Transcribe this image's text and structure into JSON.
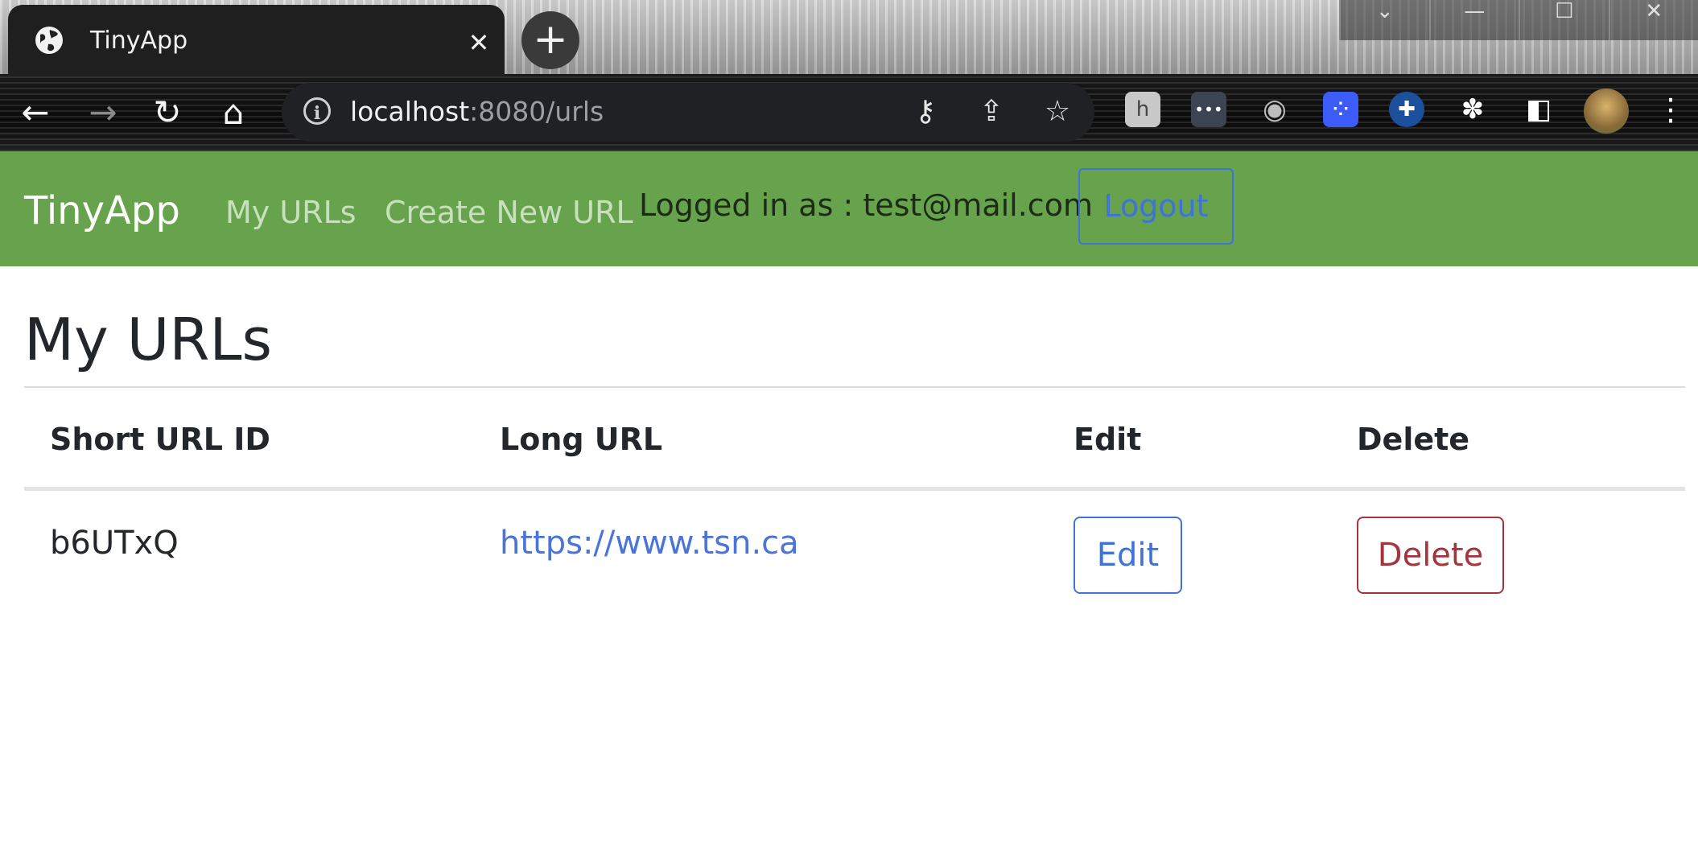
{
  "browser": {
    "tab_title": "TinyApp",
    "tab_close_glyph": "✕",
    "new_tab_glyph": "+",
    "window_controls": [
      "⌄",
      "—",
      "☐",
      "✕"
    ],
    "url_host": "localhost",
    "url_path": ":8080/urls",
    "info_glyph": "i",
    "nav_glyphs": {
      "back": "←",
      "forward": "→",
      "reload": "↻",
      "home": "⌂"
    },
    "omnibox_icons": {
      "key": "⚷",
      "share": "⇪",
      "star": "☆"
    },
    "extensions": [
      {
        "name": "honey-extension-icon",
        "glyph": "h",
        "color": "#c8c8c8"
      },
      {
        "name": "dots-extension-icon",
        "glyph": "•••",
        "color": "#3b4450"
      },
      {
        "name": "metamask-extension-icon",
        "glyph": "◉",
        "color": "#1a1a1a"
      },
      {
        "name": "grid-extension-icon",
        "glyph": "⁘",
        "color": "#3d5bf6"
      },
      {
        "name": "cross-extension-icon",
        "glyph": "✚",
        "color": "#1c4f9c"
      },
      {
        "name": "puzzle-extension-icon",
        "glyph": "✽",
        "color": "#1a1a1a"
      },
      {
        "name": "sidepanel-icon",
        "glyph": "◧",
        "color": "#1a1a1a"
      }
    ],
    "menu_glyph": "⋮"
  },
  "navbar": {
    "brand": "TinyApp",
    "links": [
      "My URLs",
      "Create New URL"
    ],
    "logged_in_text": "Logged in as : test@mail.com",
    "logout_label": "Logout"
  },
  "main": {
    "title": "My URLs",
    "table": {
      "headers": [
        "Short URL ID",
        "Long URL",
        "Edit",
        "Delete"
      ],
      "rows": [
        {
          "id": "b6UTxQ",
          "long_url": "https://www.tsn.ca",
          "edit_label": "Edit",
          "delete_label": "Delete"
        }
      ]
    }
  },
  "colors": {
    "navbar": "#67a24c",
    "primary": "#3f74d6",
    "danger": "#a5353c"
  }
}
